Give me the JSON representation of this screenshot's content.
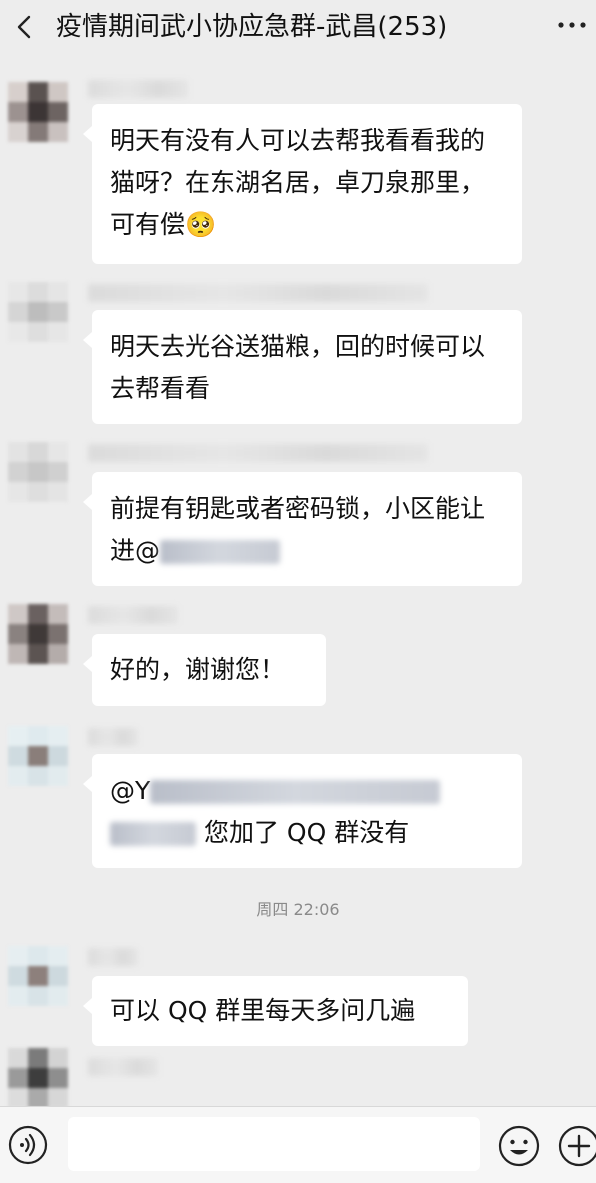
{
  "header": {
    "title": "疫情期间武小协应急群-武昌(253)"
  },
  "messages": [
    {
      "text": "明天有没有人可以去帮我看看我的猫呀？在东湖名居，卓刀泉那里，可有偿🥺"
    },
    {
      "text": "明天去光谷送猫粮，回的时候可以去帮看看"
    },
    {
      "text": "前提有钥匙或者密码锁，小区能让进@"
    },
    {
      "text": "好的，谢谢您！"
    },
    {
      "text_prefix": "@Y",
      "text_suffix": "您加了 QQ 群没有"
    },
    {
      "text": "可以 QQ 群里每天多问几遍"
    }
  ],
  "timestamp": "周四 22:06",
  "input": {
    "value": ""
  },
  "icons": {
    "back": "chevron-left-icon",
    "more": "more-icon",
    "voice": "voice-icon",
    "emoji": "emoji-icon",
    "plus": "plus-icon"
  }
}
